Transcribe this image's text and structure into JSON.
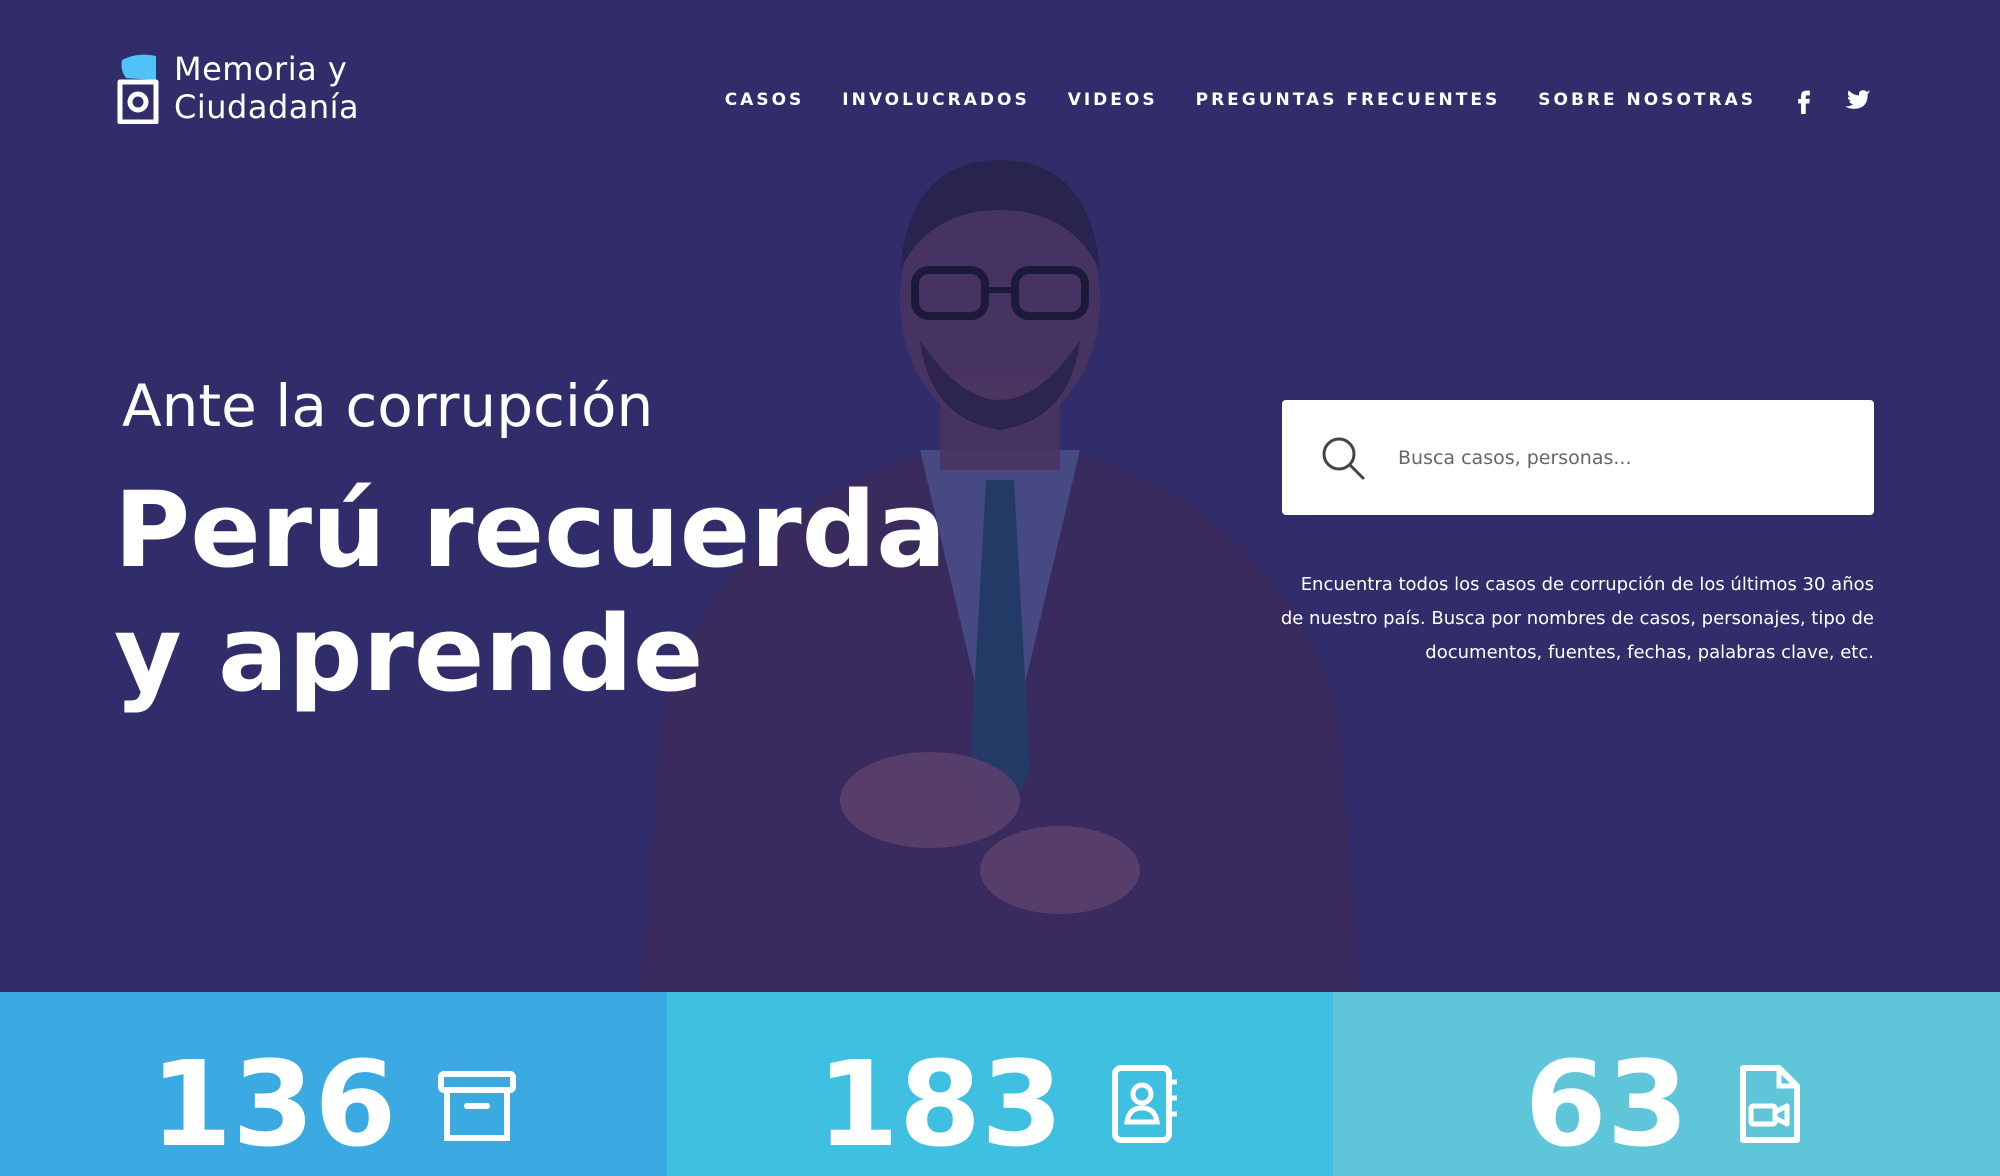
{
  "brand": {
    "line1": "Memoria y",
    "line2": "Ciudadanía"
  },
  "nav": {
    "items": [
      {
        "label": "CASOS"
      },
      {
        "label": "INVOLUCRADOS"
      },
      {
        "label": "VIDEOS"
      },
      {
        "label": "PREGUNTAS FRECUENTES"
      },
      {
        "label": "SOBRE NOSOTRAS"
      }
    ],
    "social": [
      "facebook-icon",
      "twitter-icon"
    ]
  },
  "hero": {
    "kicker": "Ante la corrupción",
    "headline_line1": "Perú recuerda",
    "headline_line2": "y aprende",
    "search_placeholder": "Busca casos, personas...",
    "description": "Encuentra todos los casos de corrupción de los últimos 30 años de nuestro país.  Busca por nombres de casos, personajes, tipo de documentos, fuentes, fechas, palabras clave, etc."
  },
  "stats": [
    {
      "value": "136",
      "icon": "archive-box-icon",
      "color": "#3baae3"
    },
    {
      "value": "183",
      "icon": "contact-book-icon",
      "color": "#3fc0e0"
    },
    {
      "value": "63",
      "icon": "video-file-icon",
      "color": "#5ec6d8"
    }
  ],
  "colors": {
    "hero_bg": "#302d6a",
    "white": "#ffffff"
  }
}
